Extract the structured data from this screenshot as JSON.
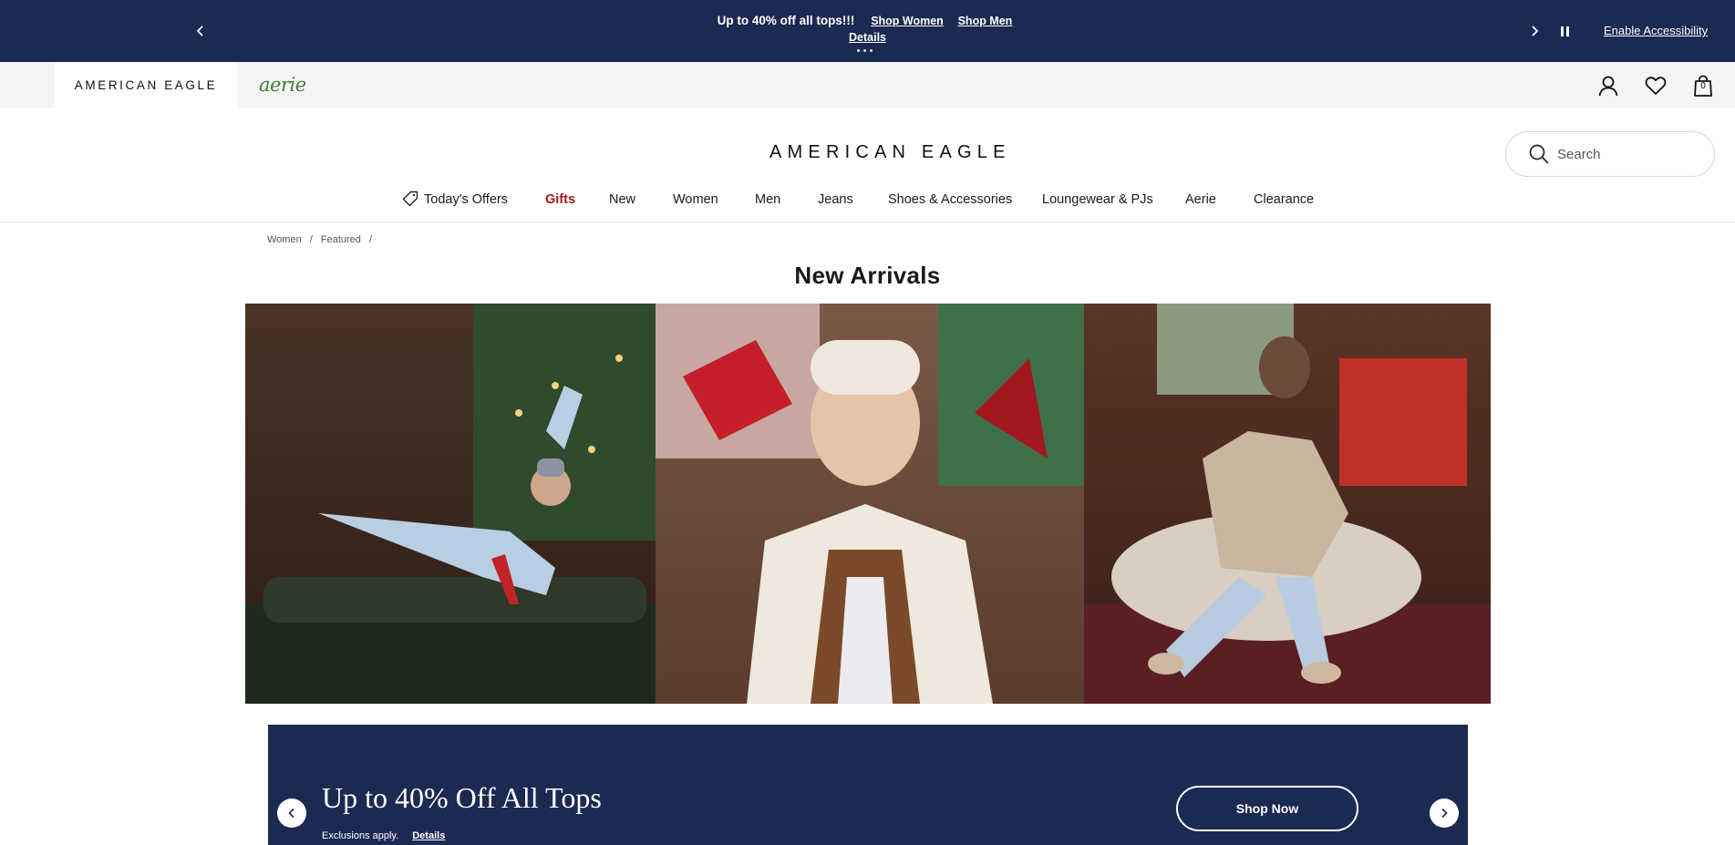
{
  "promo": {
    "headline": "Up to 40% off all tops!!!",
    "link_women": "Shop Women",
    "link_men": "Shop Men",
    "details": "Details",
    "accessibility": "Enable Accessibility"
  },
  "brands": {
    "american_eagle": "AMERICAN EAGLE",
    "aerie": "aerie"
  },
  "header": {
    "logo": "AMERICAN EAGLE",
    "bag_count": "0"
  },
  "search": {
    "placeholder": "Search"
  },
  "nav": {
    "items": [
      {
        "label": "Today's Offers"
      },
      {
        "label": "Gifts"
      },
      {
        "label": "New"
      },
      {
        "label": "Women"
      },
      {
        "label": "Men"
      },
      {
        "label": "Jeans"
      },
      {
        "label": "Shoes & Accessories"
      },
      {
        "label": "Loungewear & PJs"
      },
      {
        "label": "Aerie"
      },
      {
        "label": "Clearance"
      }
    ]
  },
  "breadcrumb": {
    "items": [
      "Women",
      "Featured"
    ],
    "separator": "/"
  },
  "page": {
    "title": "New Arrivals"
  },
  "banner": {
    "title": "Up to 40% Off All Tops",
    "note": "Exclusions apply.",
    "details": "Details",
    "cta": "Shop Now"
  },
  "colors": {
    "navy": "#1b2a52",
    "gifts_red": "#a3171f",
    "aerie_green": "#3d7a3d"
  }
}
